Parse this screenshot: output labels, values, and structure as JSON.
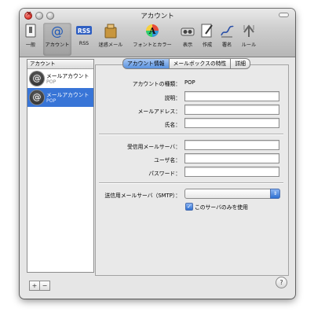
{
  "window": {
    "title": "アカウント"
  },
  "toolbar": {
    "items": [
      {
        "label": "一般",
        "icon": "switch-icon"
      },
      {
        "label": "アカウント",
        "icon": "at-sign-icon",
        "selected": true
      },
      {
        "label": "RSS",
        "icon": "rss-icon",
        "icon_text": "RSS"
      },
      {
        "label": "迷惑メール",
        "icon": "junk-mail-icon"
      },
      {
        "label": "フォントとカラー",
        "icon": "fonts-colors-icon",
        "icon_text": "A"
      },
      {
        "label": "表示",
        "icon": "viewing-icon"
      },
      {
        "label": "作成",
        "icon": "composing-icon"
      },
      {
        "label": "署名",
        "icon": "signature-icon"
      },
      {
        "label": "ルール",
        "icon": "rules-icon"
      }
    ]
  },
  "sidebar": {
    "header": "アカウント",
    "accounts": [
      {
        "name": "メールアカウント",
        "type": "POP",
        "selected": false,
        "icon_text": "@"
      },
      {
        "name": "メールアカウント",
        "type": "POP",
        "selected": true,
        "icon_text": "@"
      }
    ],
    "add_label": "+",
    "remove_label": "−"
  },
  "tabs": [
    {
      "label": "アカウント情報",
      "selected": true
    },
    {
      "label": "メールボックスの特性",
      "selected": false
    },
    {
      "label": "詳細",
      "selected": false
    }
  ],
  "form": {
    "account_type_label": "アカウントの種類：",
    "account_type_value": "POP",
    "description_label": "説明：",
    "description_value": "",
    "email_label": "メールアドレス：",
    "email_value": "",
    "fullname_label": "氏名：",
    "fullname_value": "",
    "incoming_server_label": "受信用メールサーバ：",
    "incoming_server_value": "",
    "username_label": "ユーザ名：",
    "username_value": "",
    "password_label": "パスワード：",
    "password_value": "",
    "smtp_label": "送信用メールサーバ（SMTP）：",
    "smtp_value": "",
    "only_this_server_label": "このサーバのみを使用",
    "only_this_server_checked": true
  },
  "help": {
    "label": "?"
  },
  "colors": {
    "selection": "#3875d7",
    "close_button": "#d5221a"
  }
}
